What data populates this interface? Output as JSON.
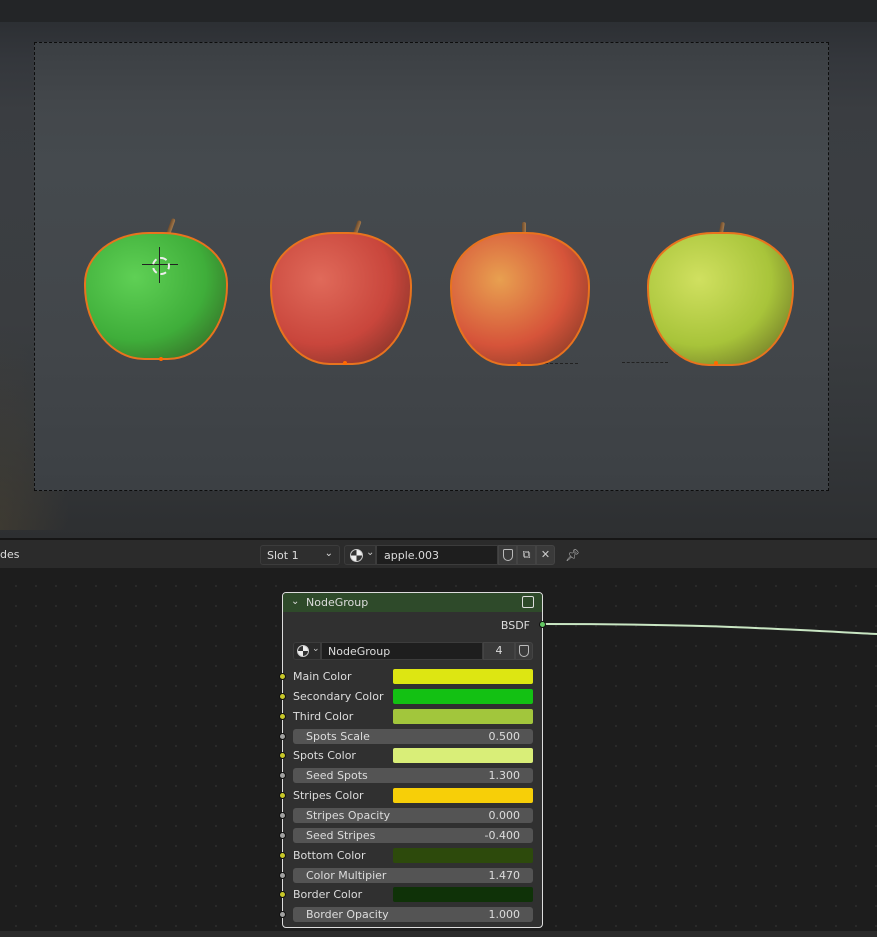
{
  "viewport": {
    "apples": [
      {
        "name": "green apple",
        "color": "#3fae3a",
        "highlight": "#5fd055"
      },
      {
        "name": "red apple",
        "color": "#c9463c",
        "highlight": "#e06a5a"
      },
      {
        "name": "striped apple",
        "color": "#d6543a",
        "highlight": "#e8a050"
      },
      {
        "name": "yellow-green apple",
        "color": "#a8c43a",
        "highlight": "#d0e060"
      }
    ]
  },
  "header": {
    "editor_label": "des",
    "slot": "Slot 1",
    "material_name": "apple.003"
  },
  "node": {
    "title": "NodeGroup",
    "output_label": "BSDF",
    "group_name": "NodeGroup",
    "group_users": "4",
    "inputs": [
      {
        "label": "Main Color",
        "type": "color",
        "value": "#dde612"
      },
      {
        "label": "Secondary Color",
        "type": "color",
        "value": "#13c113"
      },
      {
        "label": "Third Color",
        "type": "color",
        "value": "#a2c63c"
      },
      {
        "label": "Spots Scale",
        "type": "float",
        "value": "0.500"
      },
      {
        "label": "Spots Color",
        "type": "color",
        "value": "#d9ee78"
      },
      {
        "label": "Seed Spots",
        "type": "float",
        "value": "1.300"
      },
      {
        "label": "Stripes Color",
        "type": "color",
        "value": "#f7cf08"
      },
      {
        "label": "Stripes Opacity",
        "type": "float",
        "value": "0.000"
      },
      {
        "label": "Seed Stripes",
        "type": "float",
        "value": "-0.400"
      },
      {
        "label": "Bottom Color",
        "type": "color",
        "value": "#2d4a0c"
      },
      {
        "label": "Color Multipier",
        "type": "float",
        "value": "1.470"
      },
      {
        "label": "Border Color",
        "type": "color",
        "value": "#0f3208"
      },
      {
        "label": "Border Opacity",
        "type": "float",
        "value": "1.000"
      }
    ]
  }
}
